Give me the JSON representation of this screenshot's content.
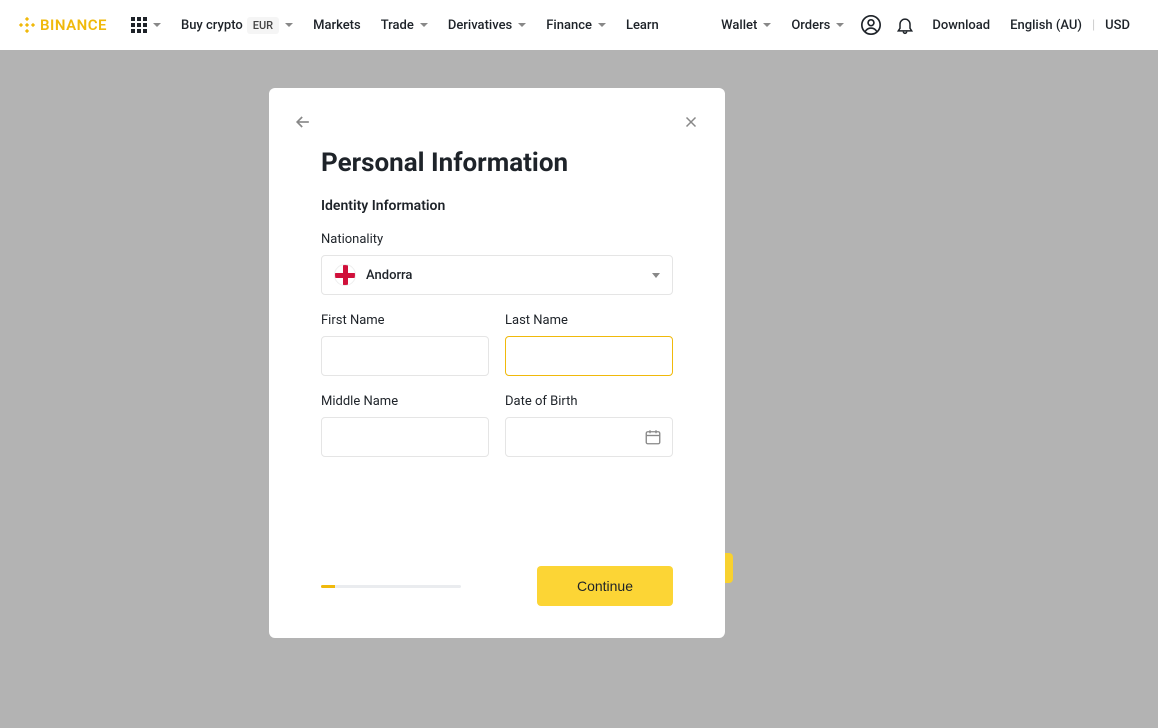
{
  "header": {
    "logo_text": "BINANCE",
    "nav": {
      "buy_crypto": "Buy crypto",
      "eur_badge": "EUR",
      "markets": "Markets",
      "trade": "Trade",
      "derivatives": "Derivatives",
      "finance": "Finance",
      "learn": "Learn"
    },
    "right": {
      "wallet": "Wallet",
      "orders": "Orders",
      "download": "Download",
      "language": "English (AU)",
      "currency": "USD"
    }
  },
  "modal": {
    "title": "Personal Information",
    "section": "Identity Information",
    "nationality_label": "Nationality",
    "nationality_value": "Andorra",
    "first_name_label": "First Name",
    "last_name_label": "Last Name",
    "middle_name_label": "Middle Name",
    "dob_label": "Date of Birth",
    "continue": "Continue"
  }
}
